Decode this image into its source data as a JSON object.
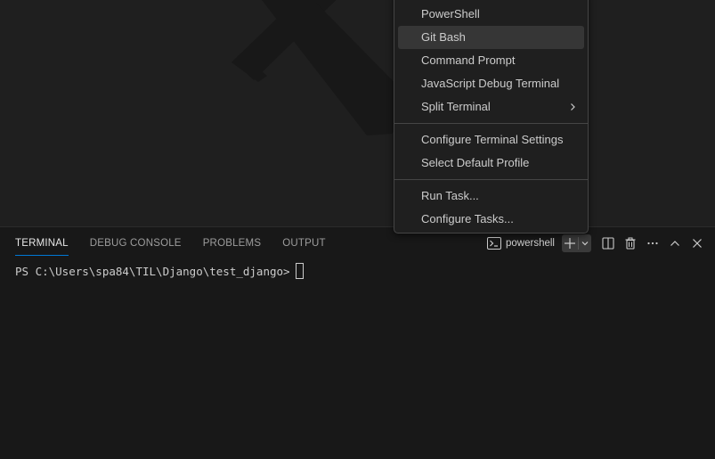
{
  "terminal_menu": {
    "groups": [
      [
        {
          "label": "PowerShell"
        },
        {
          "label": "Git Bash"
        },
        {
          "label": "Command Prompt"
        },
        {
          "label": "JavaScript Debug Terminal"
        },
        {
          "label": "Split Terminal",
          "submenu": true
        }
      ],
      [
        {
          "label": "Configure Terminal Settings"
        },
        {
          "label": "Select Default Profile"
        }
      ],
      [
        {
          "label": "Run Task..."
        },
        {
          "label": "Configure Tasks..."
        }
      ]
    ],
    "highlighted": "Git Bash"
  },
  "panel": {
    "tabs": [
      {
        "label": "TERMINAL",
        "active": true
      },
      {
        "label": "DEBUG CONSOLE",
        "active": false
      },
      {
        "label": "PROBLEMS",
        "active": false
      },
      {
        "label": "OUTPUT",
        "active": false
      }
    ],
    "profile_label": "powershell",
    "actions": {
      "new_terminal_icon": "plus-icon",
      "launch_profile_icon": "chevron-down-icon",
      "split_icon": "split-editor-icon",
      "kill_icon": "trash-icon",
      "more_icon": "ellipsis-icon",
      "maximize_icon": "chevron-up-icon",
      "close_icon": "close-icon"
    }
  },
  "terminal": {
    "prompt": "PS C:\\Users\\spa84\\TIL\\Django\\test_django>"
  },
  "colors": {
    "background": "#1f1f1f",
    "panel_background": "#181818",
    "active_tab_indicator": "#0078d4",
    "menu_highlight": "#363636",
    "text": "#cccccc"
  }
}
